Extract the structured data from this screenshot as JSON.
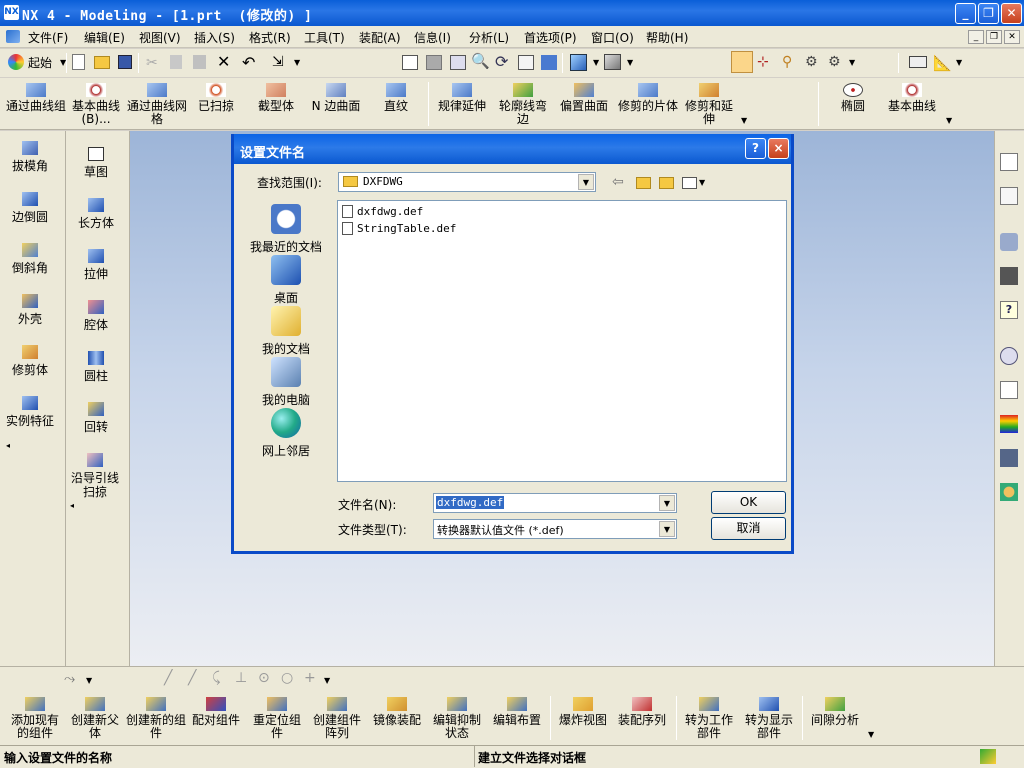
{
  "window": {
    "title": "NX 4 - Modeling - [1.prt  (修改的) ]",
    "app_icon": "nx-icon",
    "buttons": [
      "minimize",
      "restore",
      "close"
    ]
  },
  "menubar": {
    "items": [
      "文件(F)",
      "编辑(E)",
      "视图(V)",
      "插入(S)",
      "格式(R)",
      "工具(T)",
      "装配(A)",
      "信息(I)",
      "分析(L)",
      "首选项(P)",
      "窗口(O)",
      "帮助(H)"
    ]
  },
  "standard_toolbar": {
    "start_label": "起始"
  },
  "curve_toolbar": {
    "items": [
      "通过曲线组",
      "基本曲线(B)...",
      "通过曲线网格",
      "已扫掠",
      "截型体",
      "N 边曲面",
      "直纹",
      "规律延伸",
      "轮廓线弯边",
      "偏置曲面",
      "修剪的片体",
      "修剪和延伸",
      "椭圆",
      "基本曲线"
    ]
  },
  "feature_panel_left": {
    "items": [
      "拔模角",
      "边倒圆",
      "倒斜角",
      "外壳",
      "修剪体",
      "实例特征"
    ]
  },
  "feature_panel_right": {
    "items": [
      "草图",
      "长方体",
      "拉伸",
      "腔体",
      "圆柱",
      "回转",
      "沿导引线扫掠"
    ]
  },
  "dialog": {
    "title": "设置文件名",
    "look_in_label": "查找范围(I):",
    "look_in_value": "DXFDWG",
    "places": [
      "我最近的文档",
      "桌面",
      "我的文档",
      "我的电脑",
      "网上邻居"
    ],
    "files": [
      "dxfdwg.def",
      "StringTable.def"
    ],
    "filename_label": "文件名(N):",
    "filename_value": "dxfdwg.def",
    "filetype_label": "文件类型(T):",
    "filetype_value": "转换器默认值文件 (*.def)",
    "ok_label": "OK",
    "cancel_label": "取消",
    "help_label": "?",
    "close_label": "×"
  },
  "assembly_toolbar": {
    "items": [
      "添加现有的组件",
      "创建新父体",
      "创建新的组件",
      "配对组件",
      "重定位组件",
      "创建组件阵列",
      "镜像装配",
      "编辑抑制状态",
      "编辑布置",
      "爆炸视图",
      "装配序列",
      "转为工作部件",
      "转为显示部件",
      "间隙分析"
    ]
  },
  "status_bar": {
    "prompt": "输入设置文件的名称",
    "message": "建立文件选择对话框"
  },
  "colors": {
    "titlebar": "#0a5fd8",
    "canvas_top": "#9db5d8",
    "canvas_bottom": "#eceef3",
    "dialog_border": "#0a4ac8",
    "selection": "#316ac5"
  }
}
